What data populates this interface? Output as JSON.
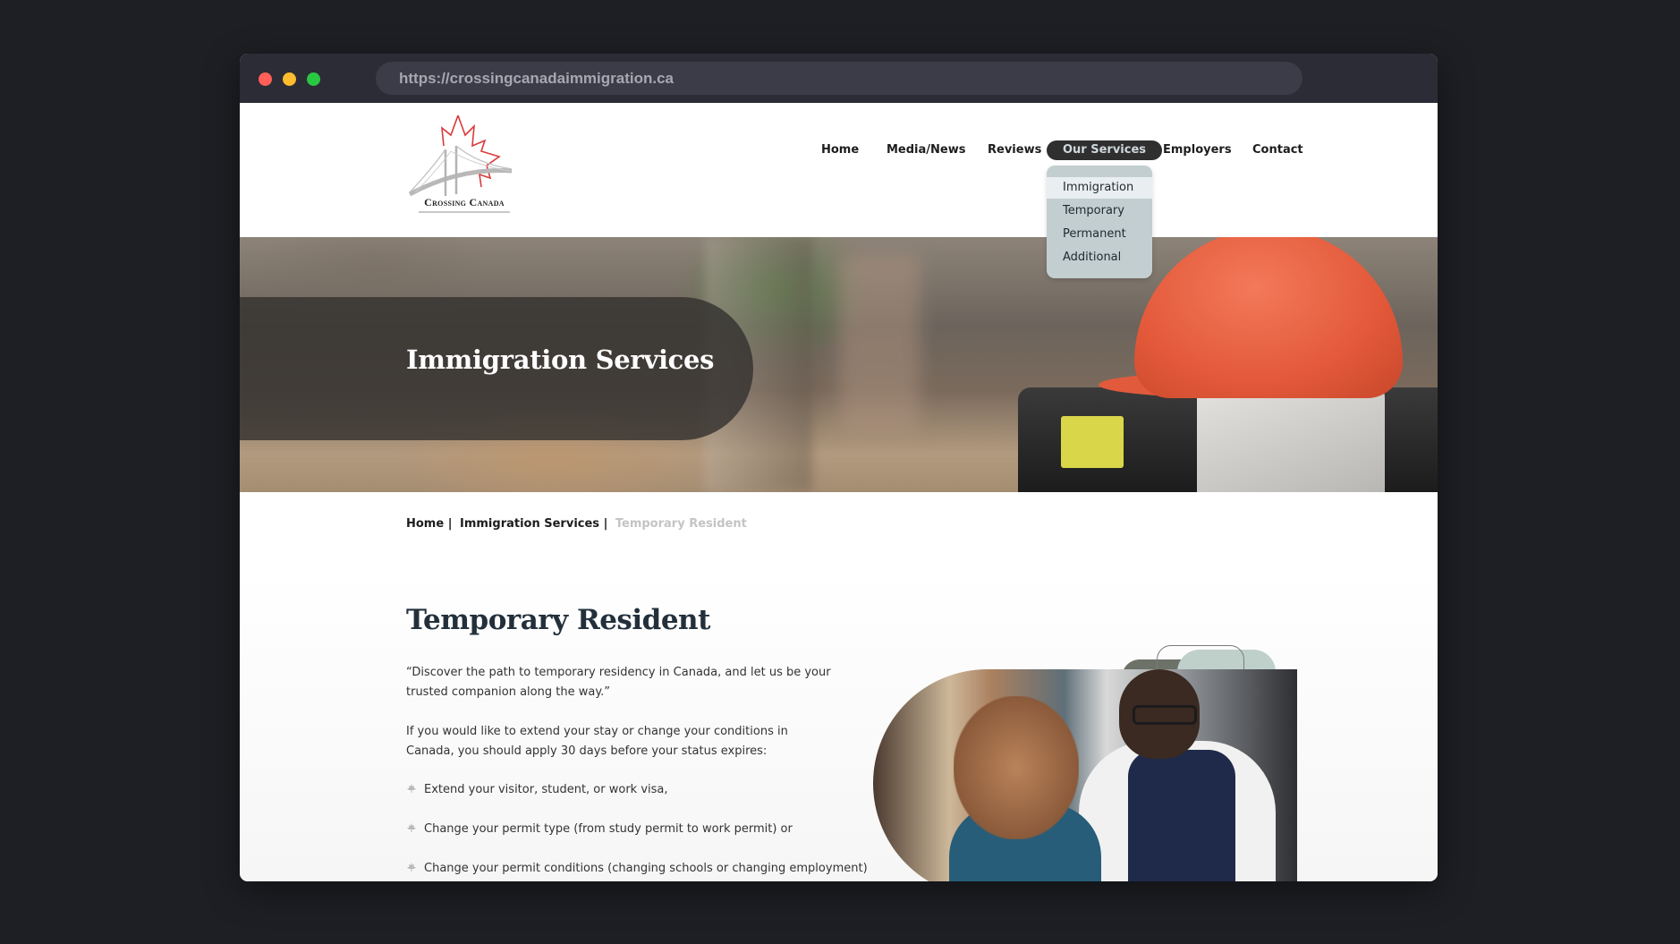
{
  "browser": {
    "url": "https://crossingcanadaimmigration.ca"
  },
  "logo": {
    "name": "Crossing Canada",
    "icon": "maple-leaf-bridge-logo"
  },
  "nav": {
    "items": [
      {
        "label": "Home"
      },
      {
        "label": "Media/News"
      },
      {
        "label": "Reviews"
      },
      {
        "label": "Our Services",
        "active": true
      },
      {
        "label": "Employers"
      },
      {
        "label": "Contact"
      }
    ],
    "dropdown": [
      {
        "label": "Immigration",
        "hovered": true
      },
      {
        "label": "Temporary"
      },
      {
        "label": "Permanent"
      },
      {
        "label": "Additional"
      }
    ]
  },
  "hero": {
    "title": "Immigration Services"
  },
  "breadcrumb": {
    "items": [
      "Home",
      "Immigration Services"
    ],
    "separator": "|",
    "current": "Temporary Resident"
  },
  "content": {
    "title": "Temporary Resident",
    "quote": "“Discover the path to temporary residency in Canada, and let us be your trusted companion along the way.”",
    "intro": "If you would like to extend your stay or change your conditions in Canada, you should apply 30 days before your status expires:",
    "bullet_icon": "maple-leaf-icon",
    "bullets": [
      "Extend your visitor, student, or work visa,",
      "Change your permit type (from study permit to work permit) or",
      "Change your permit conditions (changing schools or changing employment)"
    ]
  },
  "colors": {
    "background": "#1e1f24",
    "toolbar": "#2b2c36",
    "nav_active_bg": "#2f2f2f",
    "dropdown_bg": "#c3ced1",
    "heading": "#23303b",
    "breadcrumb_current": "#c4c4c4",
    "logo_red": "#d93a3a"
  }
}
